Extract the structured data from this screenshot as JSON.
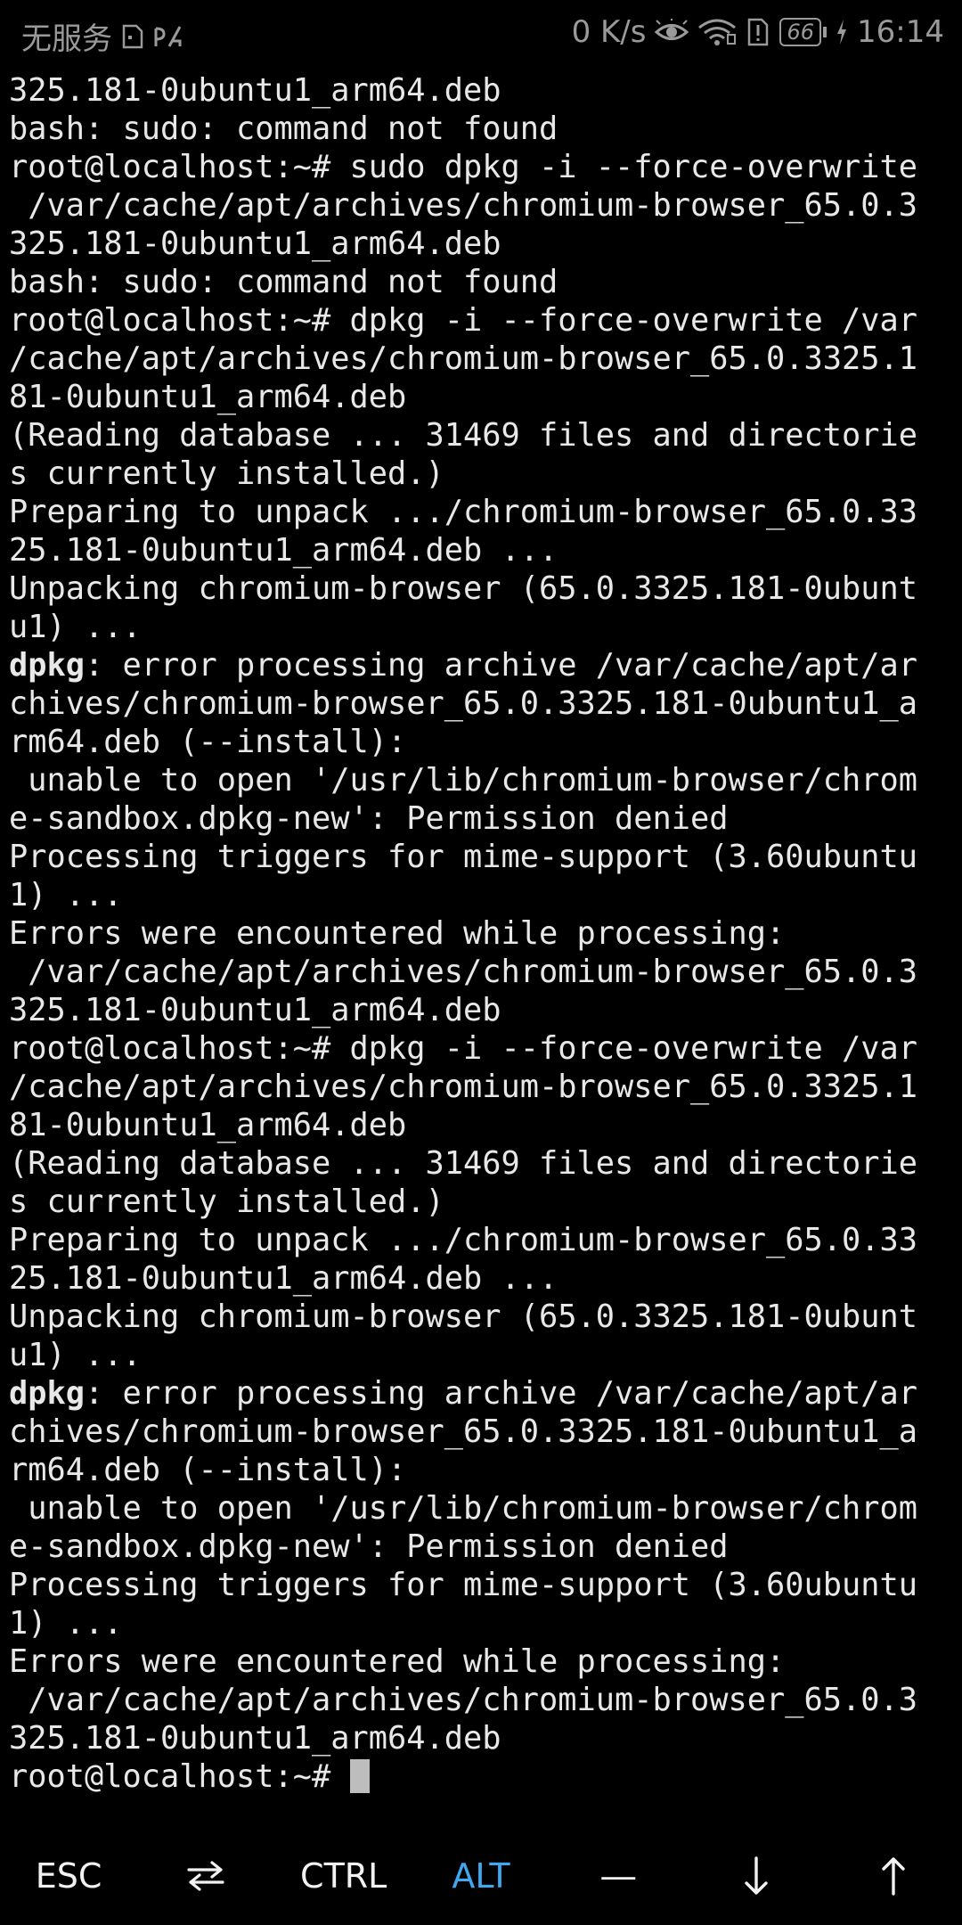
{
  "status_bar": {
    "carrier_text": "无服务",
    "net_speed": "0 K/s",
    "battery_level": "66",
    "time": "16:14",
    "icons": [
      "sim-icon",
      "data-signal-icon",
      "eye-icon",
      "wifi-icon",
      "notification-alert-icon",
      "battery-icon",
      "charging-icon"
    ]
  },
  "terminal": {
    "lines": [
      {
        "text": "325.181-0ubuntu1_arm64.deb"
      },
      {
        "text": "bash: sudo: command not found"
      },
      {
        "text": "root@localhost:~# sudo dpkg -i --force-overwrite"
      },
      {
        "text": " /var/cache/apt/archives/chromium-browser_65.0.3"
      },
      {
        "text": "325.181-0ubuntu1_arm64.deb"
      },
      {
        "text": "bash: sudo: command not found"
      },
      {
        "text": "root@localhost:~# dpkg -i --force-overwrite /var"
      },
      {
        "text": "/cache/apt/archives/chromium-browser_65.0.3325.1"
      },
      {
        "text": "81-0ubuntu1_arm64.deb"
      },
      {
        "text": "(Reading database ... 31469 files and directorie"
      },
      {
        "text": "s currently installed.)"
      },
      {
        "text": "Preparing to unpack .../chromium-browser_65.0.33"
      },
      {
        "text": "25.181-0ubuntu1_arm64.deb ..."
      },
      {
        "text": "Unpacking chromium-browser (65.0.3325.181-0ubunt"
      },
      {
        "text": "u1) ..."
      },
      {
        "bold": "dpkg",
        "text": ": error processing archive /var/cache/apt/ar"
      },
      {
        "text": "chives/chromium-browser_65.0.3325.181-0ubuntu1_a"
      },
      {
        "text": "rm64.deb (--install):"
      },
      {
        "text": " unable to open '/usr/lib/chromium-browser/chrom"
      },
      {
        "text": "e-sandbox.dpkg-new': Permission denied"
      },
      {
        "text": "Processing triggers for mime-support (3.60ubuntu"
      },
      {
        "text": "1) ..."
      },
      {
        "text": "Errors were encountered while processing:"
      },
      {
        "text": " /var/cache/apt/archives/chromium-browser_65.0.3"
      },
      {
        "text": "325.181-0ubuntu1_arm64.deb"
      },
      {
        "text": "root@localhost:~# dpkg -i --force-overwrite /var"
      },
      {
        "text": "/cache/apt/archives/chromium-browser_65.0.3325.1"
      },
      {
        "text": "81-0ubuntu1_arm64.deb"
      },
      {
        "text": "(Reading database ... 31469 files and directorie"
      },
      {
        "text": "s currently installed.)"
      },
      {
        "text": "Preparing to unpack .../chromium-browser_65.0.33"
      },
      {
        "text": "25.181-0ubuntu1_arm64.deb ..."
      },
      {
        "text": "Unpacking chromium-browser (65.0.3325.181-0ubunt"
      },
      {
        "text": "u1) ..."
      },
      {
        "bold": "dpkg",
        "text": ": error processing archive /var/cache/apt/ar"
      },
      {
        "text": "chives/chromium-browser_65.0.3325.181-0ubuntu1_a"
      },
      {
        "text": "rm64.deb (--install):"
      },
      {
        "text": " unable to open '/usr/lib/chromium-browser/chrom"
      },
      {
        "text": "e-sandbox.dpkg-new': Permission denied"
      },
      {
        "text": "Processing triggers for mime-support (3.60ubuntu"
      },
      {
        "text": "1) ..."
      },
      {
        "text": "Errors were encountered while processing:"
      },
      {
        "text": " /var/cache/apt/archives/chromium-browser_65.0.3"
      },
      {
        "text": "325.181-0ubuntu1_arm64.deb"
      }
    ],
    "prompt": "root@localhost:~# ",
    "text_color": "#e8e8e8",
    "background": "#000000",
    "cursor_color": "#bdbdbd"
  },
  "extra_keys": [
    {
      "name": "key-esc",
      "label": "ESC",
      "icon": null,
      "active": false
    },
    {
      "name": "key-tab",
      "label": "",
      "icon": "tab-arrows-icon",
      "active": false
    },
    {
      "name": "key-ctrl",
      "label": "CTRL",
      "icon": null,
      "active": false
    },
    {
      "name": "key-alt",
      "label": "ALT",
      "icon": null,
      "active": true
    },
    {
      "name": "key-dash",
      "label": "―",
      "icon": null,
      "active": false
    },
    {
      "name": "key-down",
      "label": "",
      "icon": "arrow-down-icon",
      "active": false
    },
    {
      "name": "key-up",
      "label": "",
      "icon": "arrow-up-icon",
      "active": false
    }
  ],
  "accent_color": "#3ea8f0"
}
